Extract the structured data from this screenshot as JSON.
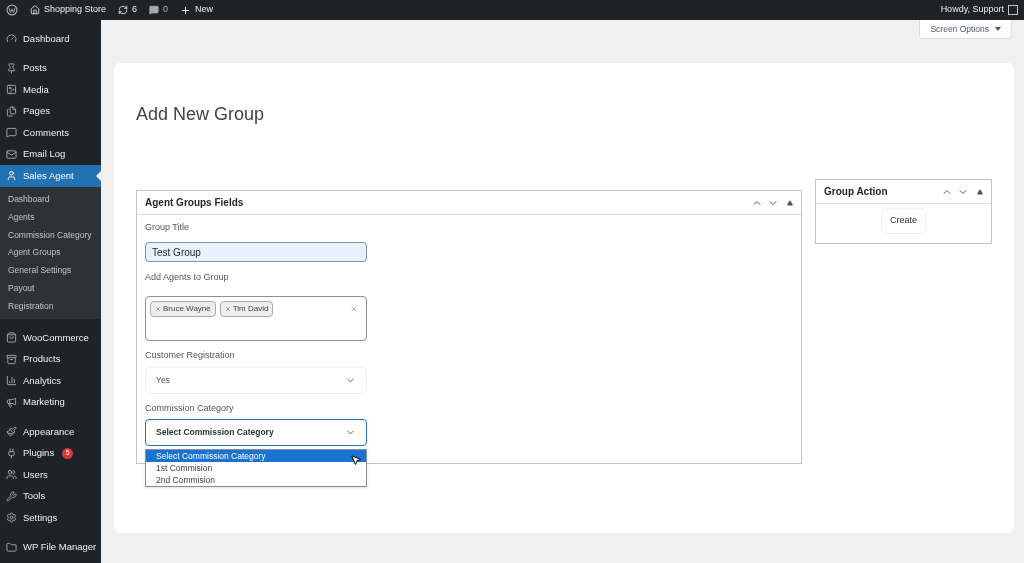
{
  "admin_bar": {
    "site": "Shopping Store",
    "updates": "6",
    "comments": "0",
    "new": "New",
    "greeting": "Howdy, Support"
  },
  "sidebar": {
    "groups": [
      [
        {
          "label": "Dashboard",
          "selected": false
        }
      ],
      [
        {
          "label": "Posts",
          "selected": false
        },
        {
          "label": "Media",
          "selected": false
        },
        {
          "label": "Pages",
          "selected": false
        },
        {
          "label": "Comments",
          "selected": false
        },
        {
          "label": "Email Log",
          "selected": false
        },
        {
          "label": "Sales Agent",
          "selected": true,
          "children": [
            {
              "label": "Dashboard",
              "selected": false
            },
            {
              "label": "Agents",
              "selected": false
            },
            {
              "label": "Commission Category",
              "selected": false
            },
            {
              "label": "Agent Groups",
              "selected": false
            },
            {
              "label": "General Settings",
              "selected": false
            },
            {
              "label": "Payout",
              "selected": false
            },
            {
              "label": "Registration",
              "selected": false
            }
          ]
        }
      ],
      [
        {
          "label": "WooCommerce",
          "selected": false
        },
        {
          "label": "Products",
          "selected": false
        },
        {
          "label": "Analytics",
          "selected": false
        },
        {
          "label": "Marketing",
          "selected": false
        }
      ],
      [
        {
          "label": "Appearance",
          "selected": false
        },
        {
          "label": "Plugins",
          "selected": false,
          "badge": "5"
        },
        {
          "label": "Users",
          "selected": false
        },
        {
          "label": "Tools",
          "selected": false
        },
        {
          "label": "Settings",
          "selected": false
        }
      ],
      [
        {
          "label": "WP File Manager",
          "selected": false
        }
      ]
    ]
  },
  "screen_options": "Screen Options",
  "page_title": "Add New Group",
  "fields_panel": {
    "title": "Agent Groups Fields",
    "fields": [
      {
        "kind": "text",
        "label": "Group Title",
        "value": "Test Group"
      },
      {
        "kind": "tags",
        "label": "Add Agents to Group",
        "tags": [
          "Bruce Wayne",
          "Tim David"
        ]
      },
      {
        "kind": "select",
        "label": "Customer Registration",
        "value": "Yes",
        "expanded": false
      },
      {
        "kind": "select",
        "label": "Commission Category",
        "value": "Select Commission Category",
        "expanded": true,
        "options": [
          {
            "label": "Select Commission Category",
            "selected": true
          },
          {
            "label": "1st Commision",
            "selected": false
          },
          {
            "label": "2nd Commision",
            "selected": false
          }
        ]
      }
    ]
  },
  "action_panel": {
    "title": "Group Action",
    "button": "Create"
  }
}
